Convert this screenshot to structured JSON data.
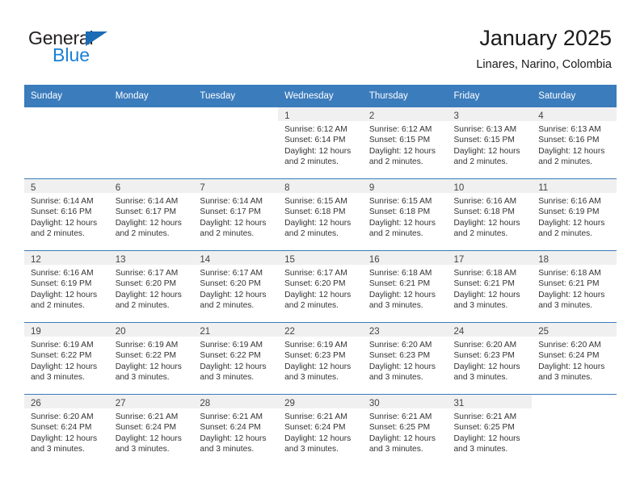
{
  "brand": {
    "name_top": "General",
    "name_bottom": "Blue",
    "triangle_color": "#1b6cb5",
    "blue_color": "#1b7fd4"
  },
  "header": {
    "title": "January 2025",
    "subtitle": "Linares, Narino, Colombia"
  },
  "theme": {
    "header_bg": "#3b7cbc",
    "daynum_bg": "#f0f0f0",
    "row_divider": "#3b7cbc"
  },
  "weekday_headers": [
    "Sunday",
    "Monday",
    "Tuesday",
    "Wednesday",
    "Thursday",
    "Friday",
    "Saturday"
  ],
  "weeks": [
    [
      {
        "day": "",
        "lines": []
      },
      {
        "day": "",
        "lines": []
      },
      {
        "day": "",
        "lines": []
      },
      {
        "day": "1",
        "lines": [
          "Sunrise: 6:12 AM",
          "Sunset: 6:14 PM",
          "Daylight: 12 hours",
          "and 2 minutes."
        ]
      },
      {
        "day": "2",
        "lines": [
          "Sunrise: 6:12 AM",
          "Sunset: 6:15 PM",
          "Daylight: 12 hours",
          "and 2 minutes."
        ]
      },
      {
        "day": "3",
        "lines": [
          "Sunrise: 6:13 AM",
          "Sunset: 6:15 PM",
          "Daylight: 12 hours",
          "and 2 minutes."
        ]
      },
      {
        "day": "4",
        "lines": [
          "Sunrise: 6:13 AM",
          "Sunset: 6:16 PM",
          "Daylight: 12 hours",
          "and 2 minutes."
        ]
      }
    ],
    [
      {
        "day": "5",
        "lines": [
          "Sunrise: 6:14 AM",
          "Sunset: 6:16 PM",
          "Daylight: 12 hours",
          "and 2 minutes."
        ]
      },
      {
        "day": "6",
        "lines": [
          "Sunrise: 6:14 AM",
          "Sunset: 6:17 PM",
          "Daylight: 12 hours",
          "and 2 minutes."
        ]
      },
      {
        "day": "7",
        "lines": [
          "Sunrise: 6:14 AM",
          "Sunset: 6:17 PM",
          "Daylight: 12 hours",
          "and 2 minutes."
        ]
      },
      {
        "day": "8",
        "lines": [
          "Sunrise: 6:15 AM",
          "Sunset: 6:18 PM",
          "Daylight: 12 hours",
          "and 2 minutes."
        ]
      },
      {
        "day": "9",
        "lines": [
          "Sunrise: 6:15 AM",
          "Sunset: 6:18 PM",
          "Daylight: 12 hours",
          "and 2 minutes."
        ]
      },
      {
        "day": "10",
        "lines": [
          "Sunrise: 6:16 AM",
          "Sunset: 6:18 PM",
          "Daylight: 12 hours",
          "and 2 minutes."
        ]
      },
      {
        "day": "11",
        "lines": [
          "Sunrise: 6:16 AM",
          "Sunset: 6:19 PM",
          "Daylight: 12 hours",
          "and 2 minutes."
        ]
      }
    ],
    [
      {
        "day": "12",
        "lines": [
          "Sunrise: 6:16 AM",
          "Sunset: 6:19 PM",
          "Daylight: 12 hours",
          "and 2 minutes."
        ]
      },
      {
        "day": "13",
        "lines": [
          "Sunrise: 6:17 AM",
          "Sunset: 6:20 PM",
          "Daylight: 12 hours",
          "and 2 minutes."
        ]
      },
      {
        "day": "14",
        "lines": [
          "Sunrise: 6:17 AM",
          "Sunset: 6:20 PM",
          "Daylight: 12 hours",
          "and 2 minutes."
        ]
      },
      {
        "day": "15",
        "lines": [
          "Sunrise: 6:17 AM",
          "Sunset: 6:20 PM",
          "Daylight: 12 hours",
          "and 2 minutes."
        ]
      },
      {
        "day": "16",
        "lines": [
          "Sunrise: 6:18 AM",
          "Sunset: 6:21 PM",
          "Daylight: 12 hours",
          "and 3 minutes."
        ]
      },
      {
        "day": "17",
        "lines": [
          "Sunrise: 6:18 AM",
          "Sunset: 6:21 PM",
          "Daylight: 12 hours",
          "and 3 minutes."
        ]
      },
      {
        "day": "18",
        "lines": [
          "Sunrise: 6:18 AM",
          "Sunset: 6:21 PM",
          "Daylight: 12 hours",
          "and 3 minutes."
        ]
      }
    ],
    [
      {
        "day": "19",
        "lines": [
          "Sunrise: 6:19 AM",
          "Sunset: 6:22 PM",
          "Daylight: 12 hours",
          "and 3 minutes."
        ]
      },
      {
        "day": "20",
        "lines": [
          "Sunrise: 6:19 AM",
          "Sunset: 6:22 PM",
          "Daylight: 12 hours",
          "and 3 minutes."
        ]
      },
      {
        "day": "21",
        "lines": [
          "Sunrise: 6:19 AM",
          "Sunset: 6:22 PM",
          "Daylight: 12 hours",
          "and 3 minutes."
        ]
      },
      {
        "day": "22",
        "lines": [
          "Sunrise: 6:19 AM",
          "Sunset: 6:23 PM",
          "Daylight: 12 hours",
          "and 3 minutes."
        ]
      },
      {
        "day": "23",
        "lines": [
          "Sunrise: 6:20 AM",
          "Sunset: 6:23 PM",
          "Daylight: 12 hours",
          "and 3 minutes."
        ]
      },
      {
        "day": "24",
        "lines": [
          "Sunrise: 6:20 AM",
          "Sunset: 6:23 PM",
          "Daylight: 12 hours",
          "and 3 minutes."
        ]
      },
      {
        "day": "25",
        "lines": [
          "Sunrise: 6:20 AM",
          "Sunset: 6:24 PM",
          "Daylight: 12 hours",
          "and 3 minutes."
        ]
      }
    ],
    [
      {
        "day": "26",
        "lines": [
          "Sunrise: 6:20 AM",
          "Sunset: 6:24 PM",
          "Daylight: 12 hours",
          "and 3 minutes."
        ]
      },
      {
        "day": "27",
        "lines": [
          "Sunrise: 6:21 AM",
          "Sunset: 6:24 PM",
          "Daylight: 12 hours",
          "and 3 minutes."
        ]
      },
      {
        "day": "28",
        "lines": [
          "Sunrise: 6:21 AM",
          "Sunset: 6:24 PM",
          "Daylight: 12 hours",
          "and 3 minutes."
        ]
      },
      {
        "day": "29",
        "lines": [
          "Sunrise: 6:21 AM",
          "Sunset: 6:24 PM",
          "Daylight: 12 hours",
          "and 3 minutes."
        ]
      },
      {
        "day": "30",
        "lines": [
          "Sunrise: 6:21 AM",
          "Sunset: 6:25 PM",
          "Daylight: 12 hours",
          "and 3 minutes."
        ]
      },
      {
        "day": "31",
        "lines": [
          "Sunrise: 6:21 AM",
          "Sunset: 6:25 PM",
          "Daylight: 12 hours",
          "and 3 minutes."
        ]
      },
      {
        "day": "",
        "lines": []
      }
    ]
  ]
}
